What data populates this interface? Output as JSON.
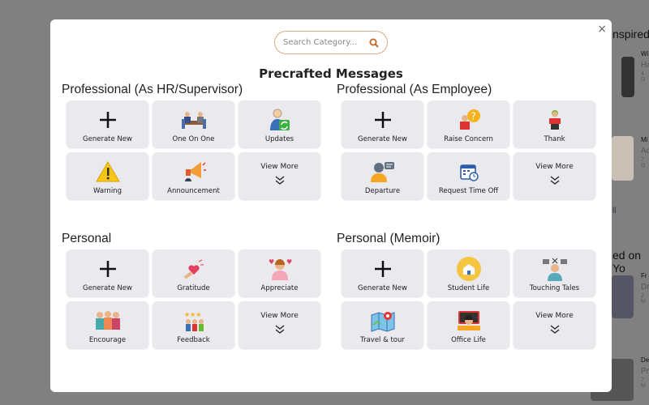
{
  "background": {
    "heading1": "nspired",
    "heading2": "ed on Yo",
    "link": "ll",
    "items": [
      {
        "t": "Wi",
        "s": "Ha",
        "d": "4 D"
      },
      {
        "t": "Mi",
        "s": "Ac",
        "d": "7 D"
      },
      {
        "t": "Fr",
        "s": "Dr",
        "d": "2 M"
      },
      {
        "t": "De",
        "s": "Pr",
        "d": "7 M"
      }
    ]
  },
  "modal": {
    "close_label": "×",
    "search": {
      "placeholder": "Search Category..."
    },
    "title": "Precrafted Messages",
    "accent": "#d9a98a",
    "sections": [
      {
        "heading": "Professional (As HR/Supervisor)",
        "cards": [
          {
            "label": "Generate New",
            "icon": "plus"
          },
          {
            "label": "One On One",
            "icon": "meeting"
          },
          {
            "label": "Updates",
            "icon": "user-refresh"
          },
          {
            "label": "Warning",
            "icon": "warning"
          },
          {
            "label": "Announcement",
            "icon": "megaphone"
          },
          {
            "label": "View More",
            "icon": "chevrons-down"
          }
        ]
      },
      {
        "heading": "Professional (As Employee)",
        "cards": [
          {
            "label": "Generate New",
            "icon": "plus"
          },
          {
            "label": "Raise Concern",
            "icon": "question-person"
          },
          {
            "label": "Thank",
            "icon": "thank-person"
          },
          {
            "label": "Departure",
            "icon": "person-speech"
          },
          {
            "label": "Request Time Off",
            "icon": "calendar"
          },
          {
            "label": "View More",
            "icon": "chevrons-down"
          }
        ]
      },
      {
        "heading": "Personal",
        "cards": [
          {
            "label": "Generate New",
            "icon": "plus"
          },
          {
            "label": "Gratitude",
            "icon": "heart-hand"
          },
          {
            "label": "Appreciate",
            "icon": "woman-hearts"
          },
          {
            "label": "Encourage",
            "icon": "group"
          },
          {
            "label": "Feedback",
            "icon": "stars-people"
          },
          {
            "label": "View More",
            "icon": "chevrons-down"
          }
        ]
      },
      {
        "heading": "Personal (Memoir)",
        "cards": [
          {
            "label": "Generate New",
            "icon": "plus"
          },
          {
            "label": "Student Life",
            "icon": "school"
          },
          {
            "label": "Touching Tales",
            "icon": "storyteller"
          },
          {
            "label": "Travel & tour",
            "icon": "map"
          },
          {
            "label": "Office Life",
            "icon": "office"
          },
          {
            "label": "View More",
            "icon": "chevrons-down"
          }
        ]
      }
    ]
  }
}
